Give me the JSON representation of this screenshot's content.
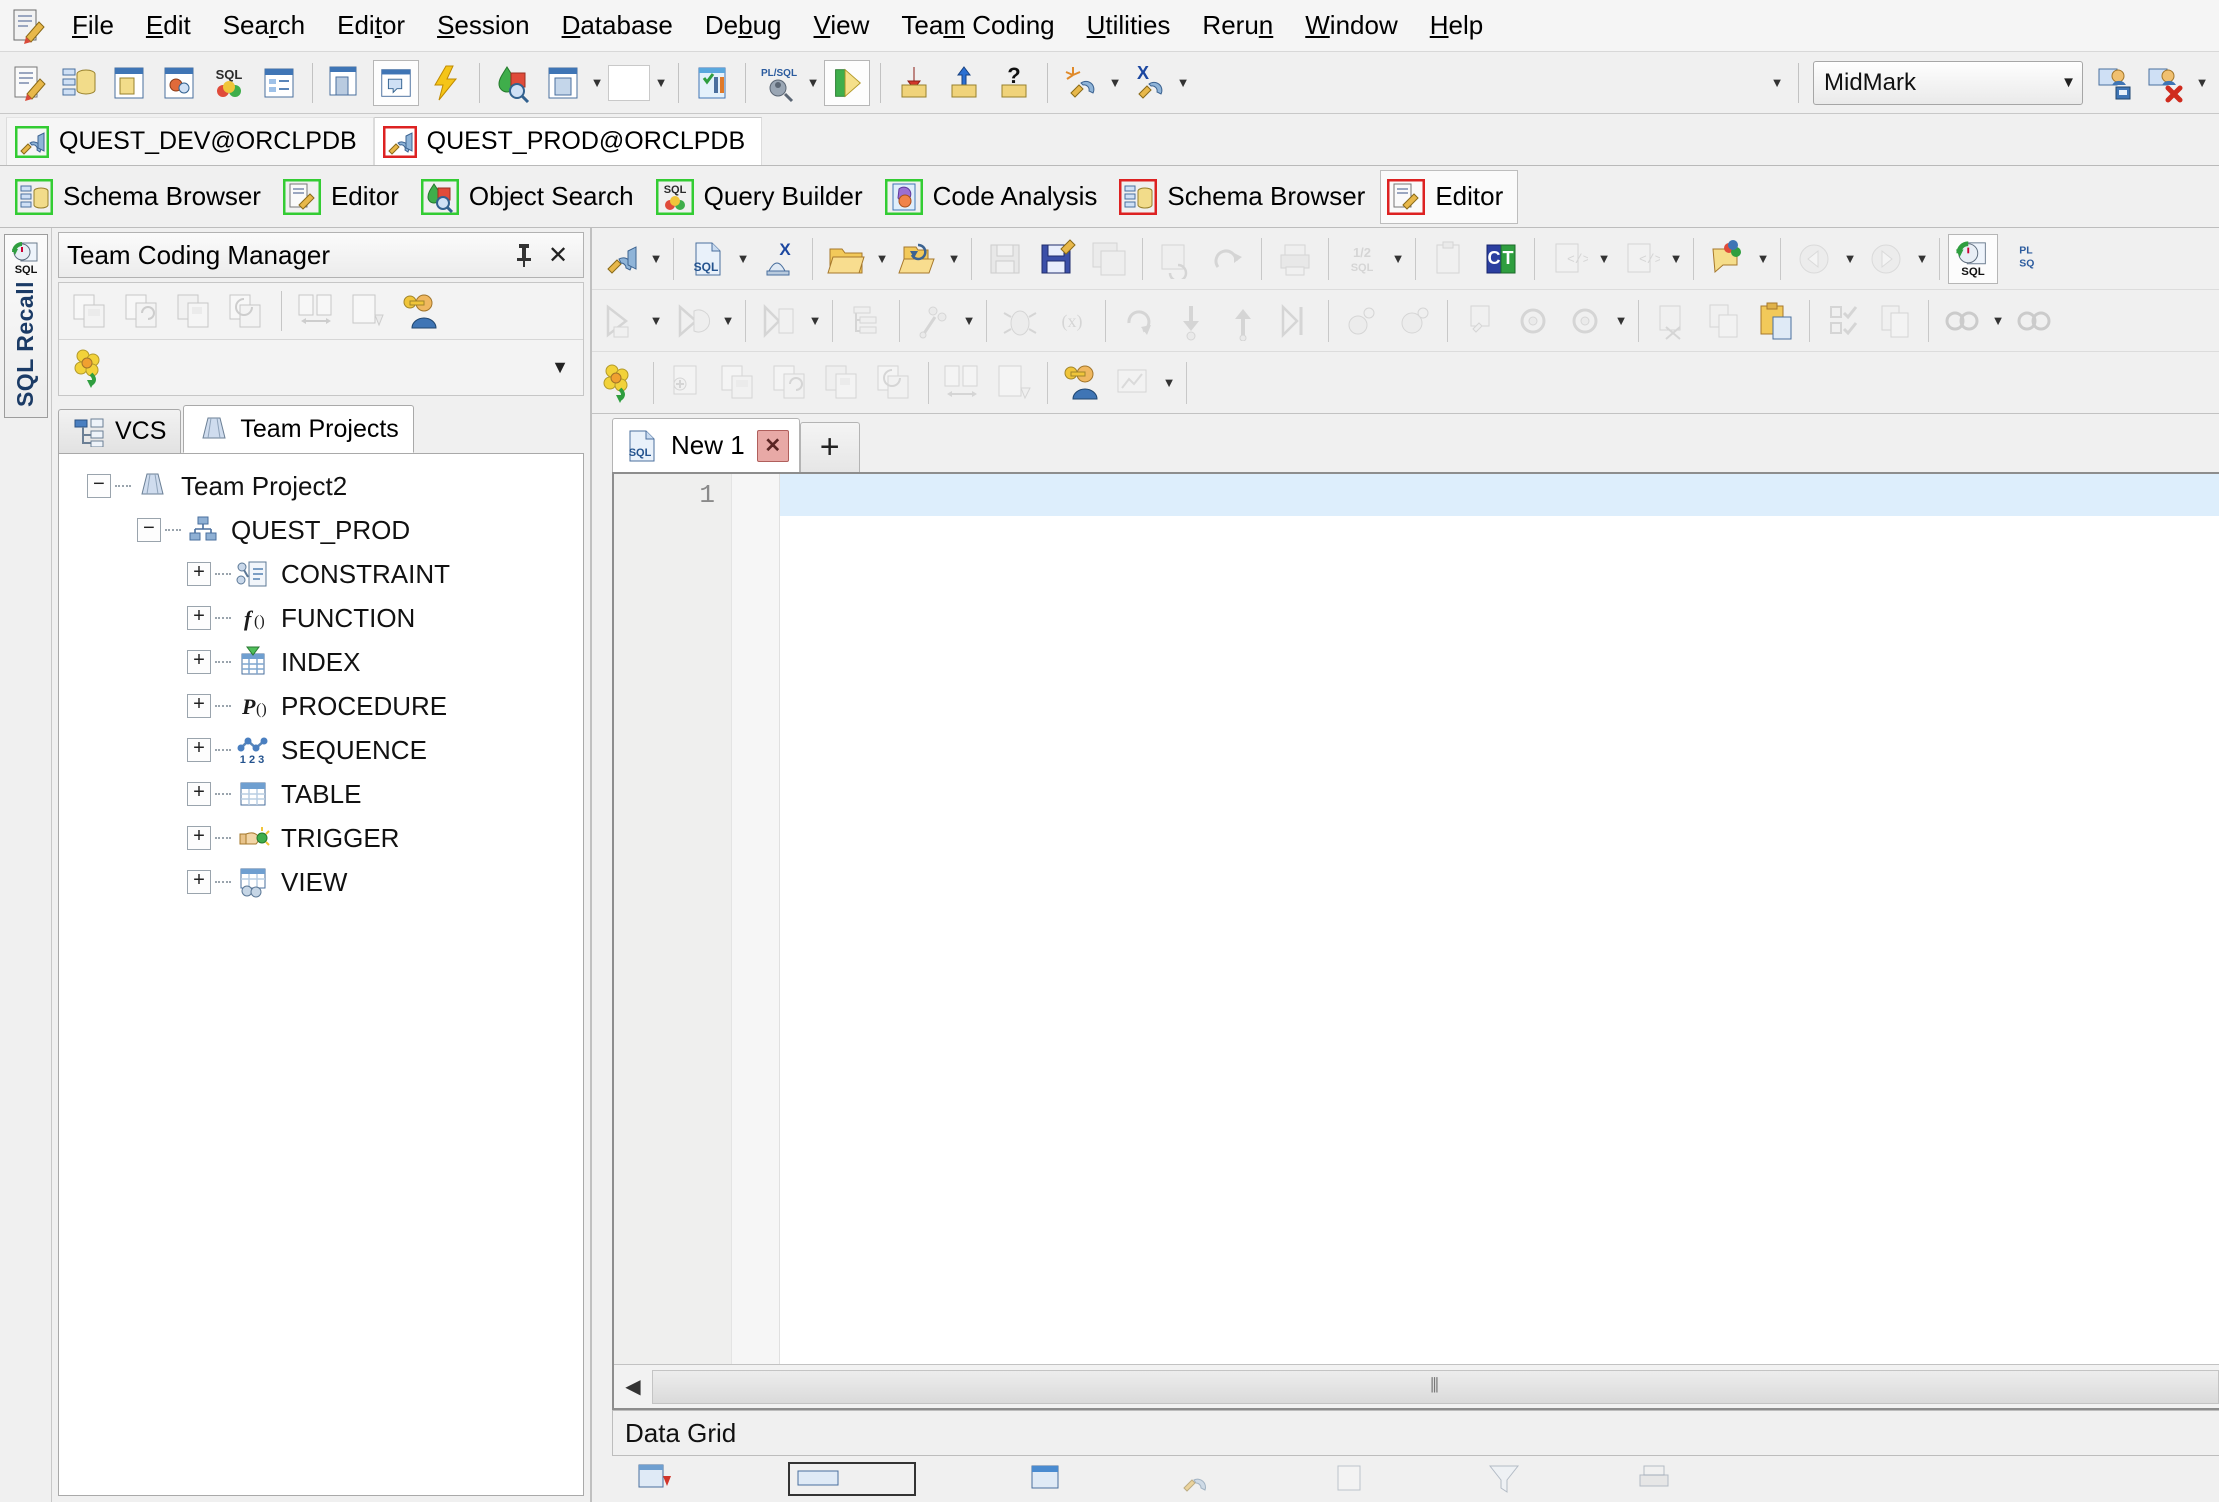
{
  "app": {
    "title": "Toad for Oracle",
    "app_icon": "editor-document-pencil-icon"
  },
  "menubar": {
    "items": [
      {
        "label": "File",
        "accel": "F"
      },
      {
        "label": "Edit",
        "accel": "E"
      },
      {
        "label": "Search",
        "accel": "r"
      },
      {
        "label": "Editor",
        "accel": "t"
      },
      {
        "label": "Session",
        "accel": "S"
      },
      {
        "label": "Database",
        "accel": "D"
      },
      {
        "label": "Debug",
        "accel": "b"
      },
      {
        "label": "View",
        "accel": "V"
      },
      {
        "label": "Team Coding",
        "accel": "m"
      },
      {
        "label": "Utilities",
        "accel": "U"
      },
      {
        "label": "Rerun",
        "accel": "n"
      },
      {
        "label": "Window",
        "accel": "W"
      },
      {
        "label": "Help",
        "accel": "H"
      }
    ]
  },
  "main_toolbar": {
    "buttons": [
      {
        "name": "new-editor-icon"
      },
      {
        "name": "schema-browser-icon"
      },
      {
        "name": "new-window-icon"
      },
      {
        "name": "object-search-window-icon"
      },
      {
        "name": "sql-query-builder-icon"
      },
      {
        "name": "describe-object-icon"
      },
      {
        "name": "session-browser-icon"
      },
      {
        "name": "sql-window-icon"
      },
      {
        "name": "execute-lightning-icon"
      },
      {
        "name": "object-search-icon"
      },
      {
        "name": "compare-window-icon"
      },
      {
        "name": "blank-white-button"
      },
      {
        "name": "sql-optimizer-icon"
      },
      {
        "name": "plsql-debugger-icon"
      },
      {
        "name": "run-script-icon"
      },
      {
        "name": "import-data-icon"
      },
      {
        "name": "export-data-icon"
      },
      {
        "name": "unknown-data-icon"
      },
      {
        "name": "new-connection-icon"
      },
      {
        "name": "disconnect-icon"
      }
    ],
    "connection_combo": {
      "value": "MidMark",
      "arrow": "▼"
    },
    "right_buttons": [
      {
        "name": "save-connection-icon"
      },
      {
        "name": "delete-connection-icon"
      }
    ]
  },
  "connection_tabs": {
    "items": [
      {
        "label": "QUEST_DEV@ORCLPDB",
        "icon": "connection-plug-icon",
        "frame_color": "#33cc33",
        "active": false
      },
      {
        "label": "QUEST_PROD@ORCLPDB",
        "icon": "connection-plug-icon",
        "frame_color": "#dd2222",
        "active": true
      }
    ]
  },
  "module_bar": {
    "items": [
      {
        "label": "Schema Browser",
        "icon": "schema-browser-icon",
        "frame_color": "#33cc33",
        "active": false
      },
      {
        "label": "Editor",
        "icon": "editor-icon",
        "frame_color": "#33cc33",
        "active": false
      },
      {
        "label": "Object Search",
        "icon": "object-search-icon",
        "frame_color": "#33cc33",
        "active": false
      },
      {
        "label": "Query Builder",
        "icon": "query-builder-icon",
        "frame_color": "#33cc33",
        "active": false
      },
      {
        "label": "Code Analysis",
        "icon": "code-analysis-icon",
        "frame_color": "#33cc33",
        "active": false
      },
      {
        "label": "Schema Browser",
        "icon": "schema-browser-icon",
        "frame_color": "#dd2222",
        "active": false
      },
      {
        "label": "Editor",
        "icon": "editor-icon",
        "frame_color": "#dd2222",
        "active": true
      }
    ]
  },
  "left_dock": {
    "vertical_tab": {
      "label": "SQL Recall",
      "icon": "sql-recall-icon"
    }
  },
  "left_panel": {
    "caption": {
      "title": "Team Coding Manager",
      "pin": "📌",
      "close": "✕"
    },
    "toolbar_row1": [
      {
        "name": "check-out-object-icon",
        "enabled": false
      },
      {
        "name": "check-in-object-icon",
        "enabled": false
      },
      {
        "name": "save-to-vcs-icon",
        "enabled": false
      },
      {
        "name": "undo-check-out-icon",
        "enabled": false
      },
      {
        "name": "compare-revisions-icon",
        "enabled": false
      },
      {
        "name": "object-history-icon",
        "enabled": false
      },
      {
        "name": "team-coding-admin-icon",
        "enabled": true
      }
    ],
    "toolbar_row2": [
      {
        "name": "refresh-flower-icon",
        "enabled": true
      }
    ],
    "toolbar_row2_caret": "▼",
    "tabs": [
      {
        "label": "VCS",
        "icon": "vcs-icon",
        "active": false
      },
      {
        "label": "Team Projects",
        "icon": "team-projects-icon",
        "active": true
      }
    ],
    "tree": [
      {
        "label": "Team Project2",
        "level": 0,
        "expander": "−",
        "icon": "team-project-icon"
      },
      {
        "label": "QUEST_PROD",
        "level": 1,
        "expander": "−",
        "icon": "provider-icon"
      },
      {
        "label": "CONSTRAINT",
        "level": 2,
        "expander": "+",
        "icon": "constraint-icon"
      },
      {
        "label": "FUNCTION",
        "level": 2,
        "expander": "+",
        "icon": "function-icon"
      },
      {
        "label": "INDEX",
        "level": 2,
        "expander": "+",
        "icon": "index-icon"
      },
      {
        "label": "PROCEDURE",
        "level": 2,
        "expander": "+",
        "icon": "procedure-icon"
      },
      {
        "label": "SEQUENCE",
        "level": 2,
        "expander": "+",
        "icon": "sequence-icon"
      },
      {
        "label": "TABLE",
        "level": 2,
        "expander": "+",
        "icon": "table-icon"
      },
      {
        "label": "TRIGGER",
        "level": 2,
        "expander": "+",
        "icon": "trigger-icon"
      },
      {
        "label": "VIEW",
        "level": 2,
        "expander": "+",
        "icon": "view-icon"
      }
    ]
  },
  "editor": {
    "toolbar_row1": [
      {
        "name": "connection-plug-icon"
      },
      {
        "name": "new-sql-file-icon"
      },
      {
        "name": "close-sql-icon"
      },
      {
        "name": "open-folder-icon"
      },
      {
        "name": "open-recent-icon"
      },
      {
        "name": "save-icon"
      },
      {
        "name": "save-as-icon"
      },
      {
        "name": "save-all-icon"
      },
      {
        "name": "revert-icon"
      },
      {
        "name": "sync-icon"
      },
      {
        "name": "print-icon"
      },
      {
        "name": "format-sql-icon"
      },
      {
        "name": "clipboard-icon"
      },
      {
        "name": "code-templates-icon"
      },
      {
        "name": "insert-snippet-icon"
      },
      {
        "name": "snippet-options-icon"
      },
      {
        "name": "bookmark-icon"
      },
      {
        "name": "navigate-back-icon"
      },
      {
        "name": "navigate-forward-icon"
      },
      {
        "name": "sql-recall-icon"
      }
    ],
    "toolbar_row2": [
      {
        "name": "execute-statement-icon"
      },
      {
        "name": "execute-as-script-icon"
      },
      {
        "name": "execute-to-file-icon"
      },
      {
        "name": "explain-plan-icon"
      },
      {
        "name": "auto-trace-icon"
      },
      {
        "name": "debug-icon"
      },
      {
        "name": "watch-variables-icon"
      },
      {
        "name": "run-to-cursor-icon"
      },
      {
        "name": "step-into-icon"
      },
      {
        "name": "step-over-icon"
      },
      {
        "name": "trace-into-icon"
      },
      {
        "name": "set-parameters-icon"
      },
      {
        "name": "add-breakpoint-icon"
      },
      {
        "name": "compile-icon"
      },
      {
        "name": "compile-dependencies-icon"
      },
      {
        "name": "cut-icon"
      },
      {
        "name": "copy-icon"
      },
      {
        "name": "paste-icon"
      },
      {
        "name": "check-syntax-icon"
      },
      {
        "name": "duplicate-icon"
      },
      {
        "name": "find-icon"
      },
      {
        "name": "find-next-icon"
      }
    ],
    "toolbar_row3": [
      {
        "name": "refresh-flower-icon"
      },
      {
        "name": "add-object-icon"
      },
      {
        "name": "check-out-object-icon"
      },
      {
        "name": "check-in-object-icon"
      },
      {
        "name": "save-to-vcs-icon"
      },
      {
        "name": "undo-check-out-icon"
      },
      {
        "name": "compare-revisions-icon"
      },
      {
        "name": "object-history-icon"
      },
      {
        "name": "team-coding-admin-icon"
      },
      {
        "name": "team-coding-report-icon"
      }
    ],
    "tabs": [
      {
        "label": "New 1",
        "icon": "sql-file-icon",
        "close": "✕",
        "active": true
      }
    ],
    "add_tab_label": "+",
    "line_numbers": [
      "1"
    ],
    "content": "",
    "hscroll_grip": "⦀"
  },
  "bottom": {
    "data_grid_label": "Data Grid",
    "scroll_left_arrow": "◀"
  }
}
